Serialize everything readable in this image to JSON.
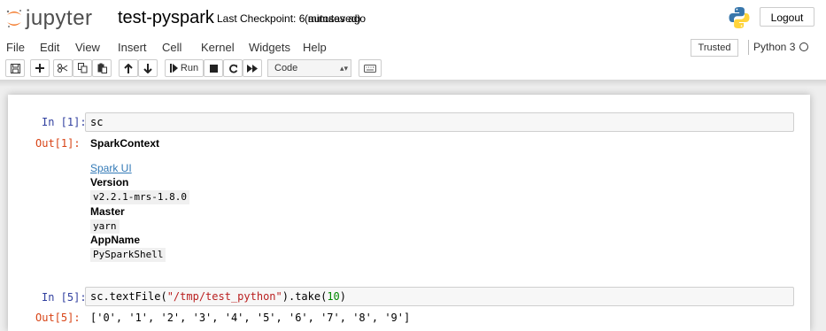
{
  "header": {
    "logo_text": "jupyter",
    "notebook_name": "test-pyspark",
    "checkpoint_text": "Last Checkpoint: 6 minutes ago",
    "autosave_text": "(autosaved)",
    "logout_label": "Logout",
    "python_logo_icon": "python-logo-icon"
  },
  "menubar": {
    "items": [
      "File",
      "Edit",
      "View",
      "Insert",
      "Cell",
      "Kernel",
      "Widgets",
      "Help"
    ],
    "trusted_label": "Trusted",
    "kernel_name": "Python 3",
    "kernel_status": "idle"
  },
  "toolbar": {
    "buttons": [
      "save-icon",
      "plus-icon",
      "cut-icon",
      "copy-icon",
      "paste-icon",
      "arrow-up-icon",
      "arrow-down-icon",
      "run-button",
      "stop-icon",
      "restart-icon",
      "fast-forward-icon",
      "keyboard-icon"
    ],
    "run_label": "Run",
    "cell_type": "Code"
  },
  "cells": [
    {
      "in_prompt": "In [1]:",
      "code": "sc",
      "out_prompt": "Out[1]:",
      "output": {
        "title": "SparkContext",
        "link_label": "Spark UI",
        "version_label": "Version",
        "version_value": "v2.2.1-mrs-1.8.0",
        "master_label": "Master",
        "master_value": "yarn",
        "appname_label": "AppName",
        "appname_value": "PySparkShell"
      }
    },
    {
      "in_prompt": "In [5]:",
      "code_parts": {
        "name": "sc.textFile(",
        "str": "\"/tmp/test_python\"",
        "mid": ").take(",
        "num": "10",
        "end": ")"
      },
      "out_prompt": "Out[5]:",
      "output_text": "['0', '1', '2', '3', '4', '5', '6', '7', '8', '9']"
    }
  ],
  "colors": {
    "in_prompt": "#303f9f",
    "out_prompt": "#d84315",
    "jupyter_orange": "#f37726",
    "link": "#337ab7"
  }
}
